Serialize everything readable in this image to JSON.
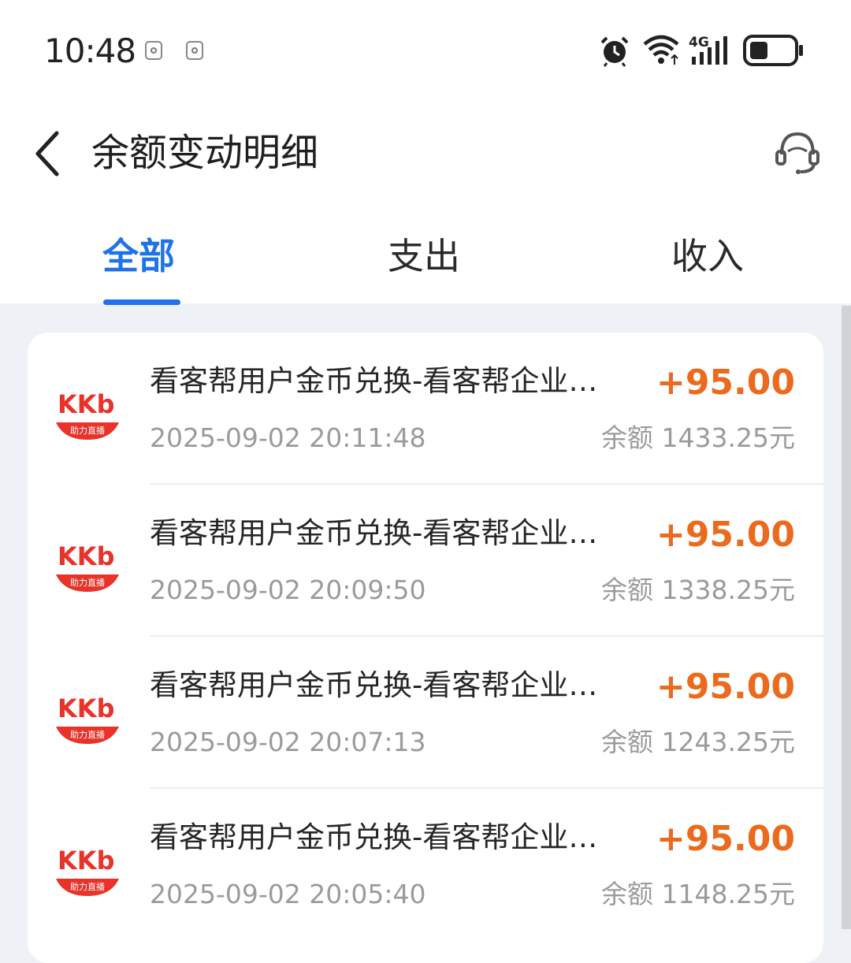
{
  "status_bar": {
    "time": "10:48",
    "network": "4G"
  },
  "header": {
    "title": "余额变动明细",
    "back_icon": "chevron-left-icon",
    "service_icon": "customer-service-icon"
  },
  "tabs": [
    {
      "label": "全部",
      "active": true
    },
    {
      "label": "支出",
      "active": false
    },
    {
      "label": "收入",
      "active": false
    }
  ],
  "colors": {
    "accent": "#1f73e8",
    "amount": "#ec6a1e",
    "logo_red": "#e8332a"
  },
  "logo": {
    "brand": "KKb",
    "sub": "助力直播"
  },
  "balance_prefix": "余额",
  "transactions": [
    {
      "title": "看客帮用户金币兑换-看客帮企业…",
      "amount": "+95.00",
      "time": "2025-09-02 20:11:48",
      "balance": "1433.25元"
    },
    {
      "title": "看客帮用户金币兑换-看客帮企业…",
      "amount": "+95.00",
      "time": "2025-09-02 20:09:50",
      "balance": "1338.25元"
    },
    {
      "title": "看客帮用户金币兑换-看客帮企业…",
      "amount": "+95.00",
      "time": "2025-09-02 20:07:13",
      "balance": "1243.25元"
    },
    {
      "title": "看客帮用户金币兑换-看客帮企业…",
      "amount": "+95.00",
      "time": "2025-09-02 20:05:40",
      "balance": "1148.25元"
    }
  ]
}
